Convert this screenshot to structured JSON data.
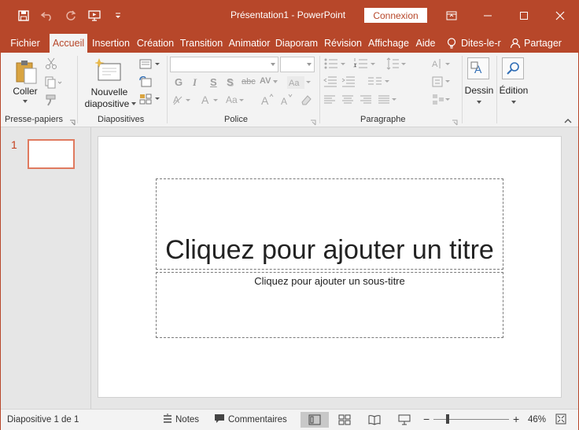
{
  "window": {
    "title": "Présentation1 -  PowerPoint",
    "connexion_label": "Connexion"
  },
  "tabs": [
    "Fichier",
    "Accueil",
    "Insertion",
    "Création",
    "Transition",
    "Animatior",
    "Diaporam",
    "Révision",
    "Affichage",
    "Aide",
    "Dites-le-r",
    "Partager"
  ],
  "ribbon": {
    "groups": {
      "clipboard": "Presse-papiers",
      "slides": "Diapositives",
      "font": "Police",
      "paragraph": "Paragraphe"
    },
    "coller": "Coller",
    "nouvelle": "Nouvelle",
    "diapositive": "diapositive",
    "dessin": "Dessin",
    "edition": "Édition",
    "font_buttons": [
      "G",
      "I",
      "S",
      "S",
      "abc",
      "AV"
    ]
  },
  "thumbnails": [
    {
      "number": "1"
    }
  ],
  "slide": {
    "title_placeholder": "Cliquez pour ajouter un titre",
    "subtitle_placeholder": "Cliquez pour ajouter un sous-titre"
  },
  "status": {
    "slide_info": "Diapositive 1 de 1",
    "notes": "Notes",
    "comments": "Commentaires",
    "zoom_percent": "46%",
    "zoom_minus": "−",
    "zoom_plus": "+",
    "zoom_value": 0.46
  },
  "colors": {
    "accent": "#b7472a",
    "ribbon": "#f3f3f3",
    "workspace": "#e6e6e6"
  }
}
